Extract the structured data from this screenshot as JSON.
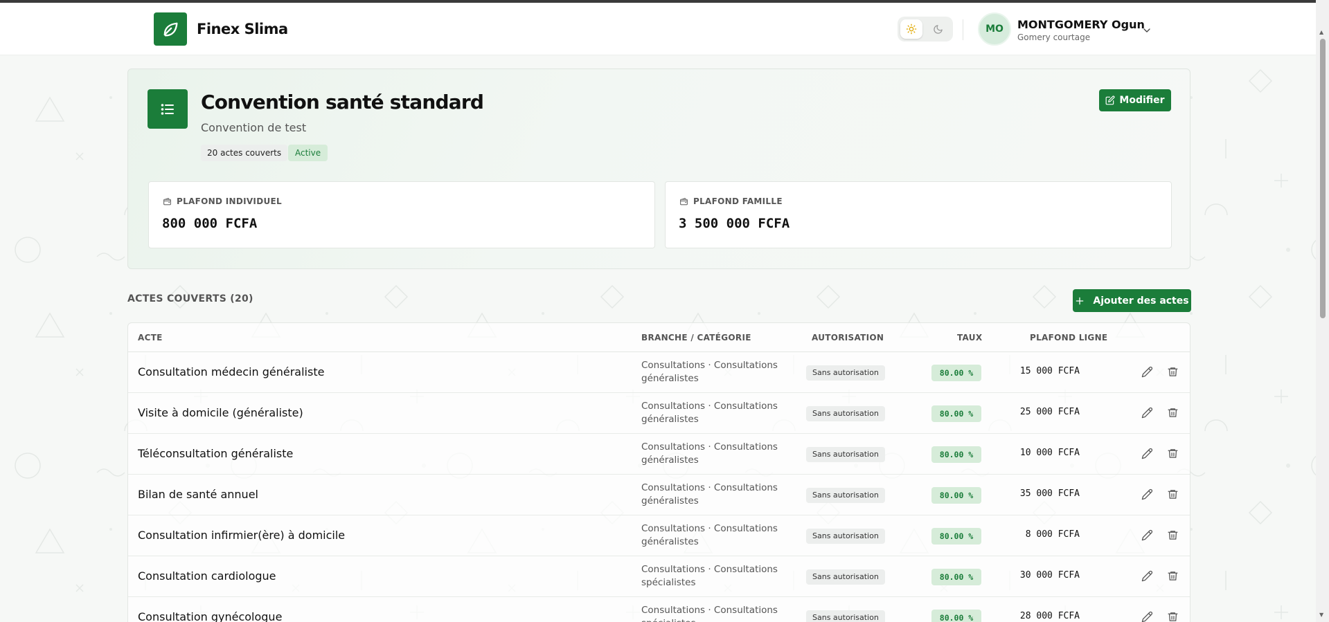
{
  "app": {
    "name": "Finex Slima"
  },
  "user": {
    "initials": "MO",
    "name": "MONTGOMERY Ogun",
    "organization": "Gomery courtage"
  },
  "convention": {
    "title": "Convention santé standard",
    "subtitle": "Convention de test",
    "badge_count": "20 actes couverts",
    "badge_status": "Active",
    "modify_label": "Modifier"
  },
  "plafonds": {
    "individuel_label": "PLAFOND INDIVIDUEL",
    "individuel_value": "800 000 FCFA",
    "famille_label": "PLAFOND FAMILLE",
    "famille_value": "3 500 000 FCFA"
  },
  "actes": {
    "section_title": "ACTES COUVERTS (20)",
    "add_label": "Ajouter des actes",
    "columns": {
      "acte": "ACTE",
      "branche": "BRANCHE / CATÉGORIE",
      "autorisation": "AUTORISATION",
      "taux": "TAUX",
      "plafond": "PLAFOND LIGNE"
    },
    "rows": [
      {
        "acte": "Consultation médecin généraliste",
        "branche": "Consultations · Consultations généralistes",
        "autorisation": "Sans autorisation",
        "taux": "80.00 %",
        "plafond": "15 000 FCFA"
      },
      {
        "acte": "Visite à domicile (généraliste)",
        "branche": "Consultations · Consultations généralistes",
        "autorisation": "Sans autorisation",
        "taux": "80.00 %",
        "plafond": "25 000 FCFA"
      },
      {
        "acte": "Téléconsultation généraliste",
        "branche": "Consultations · Consultations généralistes",
        "autorisation": "Sans autorisation",
        "taux": "80.00 %",
        "plafond": "10 000 FCFA"
      },
      {
        "acte": "Bilan de santé annuel",
        "branche": "Consultations · Consultations généralistes",
        "autorisation": "Sans autorisation",
        "taux": "80.00 %",
        "plafond": "35 000 FCFA"
      },
      {
        "acte": "Consultation infirmier(ère) à domicile",
        "branche": "Consultations · Consultations généralistes",
        "autorisation": "Sans autorisation",
        "taux": "80.00 %",
        "plafond": "8 000 FCFA"
      },
      {
        "acte": "Consultation cardiologue",
        "branche": "Consultations · Consultations spécialistes",
        "autorisation": "Sans autorisation",
        "taux": "80.00 %",
        "plafond": "30 000 FCFA"
      },
      {
        "acte": "Consultation gynécologue",
        "branche": "Consultations · Consultations spécialistes",
        "autorisation": "Sans autorisation",
        "taux": "80.00 %",
        "plafond": "28 000 FCFA"
      }
    ]
  },
  "colors": {
    "brand": "#1b7d3a",
    "brand_soft": "#d6ecd9"
  },
  "icons": {
    "logo": "leaf-icon",
    "theme_light": "sun-icon",
    "theme_dark": "moon-icon",
    "user_menu": "chevron-down-icon",
    "convention": "list-icon",
    "modify": "edit-icon",
    "plafond": "wallet-icon",
    "add": "plus-icon",
    "row_edit": "pencil-icon",
    "row_delete": "trash-icon"
  }
}
